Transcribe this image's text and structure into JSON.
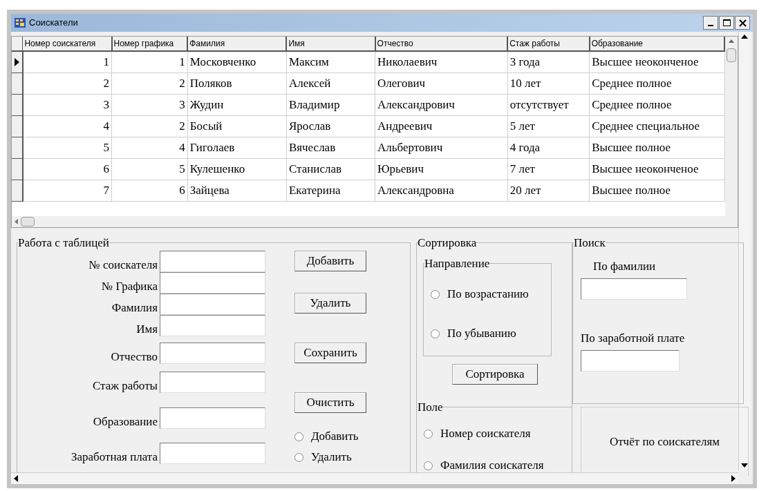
{
  "window": {
    "title": "Соискатели"
  },
  "table": {
    "columns": [
      "Номер соискателя",
      "Номер графика",
      "Фамилия",
      "Имя",
      "Отчество",
      "Стаж работы",
      "Образование"
    ],
    "rows": [
      {
        "selected": true,
        "cells": [
          "1",
          "1",
          "Московченко",
          "Максим",
          "Николаевич",
          "3 года",
          "Высшее неоконченое"
        ]
      },
      {
        "selected": false,
        "cells": [
          "2",
          "2",
          "Поляков",
          "Алексей",
          "Олегович",
          "10 лет",
          "Среднее полное"
        ]
      },
      {
        "selected": false,
        "cells": [
          "3",
          "3",
          "Жудин",
          "Владимир",
          "Александрович",
          "отсутствует",
          "Среднее полное"
        ]
      },
      {
        "selected": false,
        "cells": [
          "4",
          "2",
          "Босый",
          "Ярослав",
          "Андреевич",
          "5 лет",
          "Среднее специальное"
        ]
      },
      {
        "selected": false,
        "cells": [
          "5",
          "4",
          "Гиголаев",
          "Вячеслав",
          "Альбертович",
          "4 года",
          "Высшее полное"
        ]
      },
      {
        "selected": false,
        "cells": [
          "6",
          "5",
          "Кулешенко",
          "Станислав",
          "Юрьевич",
          "7 лет",
          "Высшее неоконченое"
        ]
      },
      {
        "selected": false,
        "cells": [
          "7",
          "6",
          "Зайцева",
          "Екатерина",
          "Александровна",
          "20 лет",
          "Высшее полное"
        ]
      }
    ]
  },
  "edit_group": {
    "title": "Работа с таблицей",
    "fields": [
      {
        "label": "№ соискателя"
      },
      {
        "label": "№ Графика"
      },
      {
        "label": "Фамилия"
      },
      {
        "label": "Имя"
      },
      {
        "label": "Отчество"
      },
      {
        "label": "Стаж работы"
      },
      {
        "label": "Образование"
      },
      {
        "label": "Заработная плата"
      }
    ],
    "buttons": [
      "Добавить",
      "Удалить",
      "Сохранить",
      "Очистить"
    ],
    "radios": [
      {
        "label": "Добавить",
        "selected": false
      },
      {
        "label": "Удалить",
        "selected": false
      }
    ]
  },
  "sort_group": {
    "title": "Сортировка",
    "direction": {
      "title": "Направление",
      "radios": [
        {
          "label": "По возрастанию",
          "selected": false
        },
        {
          "label": "По убыванию",
          "selected": false
        }
      ]
    },
    "button": "Сортировка"
  },
  "search_group": {
    "title": "Поиск",
    "fields": [
      {
        "label": "По фамилии"
      },
      {
        "label": "По заработной плате"
      }
    ]
  },
  "field_group": {
    "title": "Поле",
    "radios": [
      {
        "label": "Номер соискателя",
        "selected": false
      },
      {
        "label": "Фамилия соискателя",
        "selected": false
      }
    ]
  },
  "report_panel": {
    "label": "Отчёт по соискателям"
  }
}
